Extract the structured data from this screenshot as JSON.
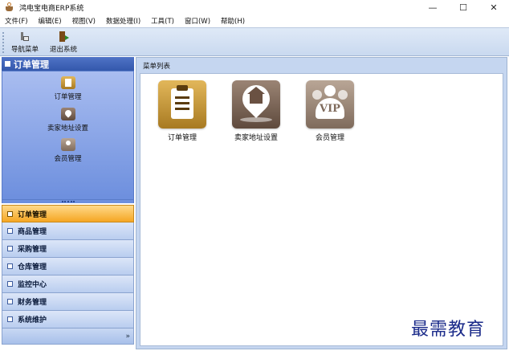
{
  "window": {
    "title": "鸿电宝电商ERP系统",
    "minimize": "—",
    "maximize": "☐",
    "close": "✕"
  },
  "menu": [
    "文件(F)",
    "编辑(E)",
    "视图(V)",
    "数据处理(I)",
    "工具(T)",
    "窗口(W)",
    "帮助(H)"
  ],
  "toolbar": {
    "nav_label": "导航菜单",
    "exit_label": "退出系统"
  },
  "left": {
    "header": "订单管理",
    "items": [
      "订单管理",
      "卖家地址设置",
      "会员管理"
    ],
    "groups": [
      {
        "label": "订单管理",
        "active": true
      },
      {
        "label": "商品管理"
      },
      {
        "label": "采购管理"
      },
      {
        "label": "仓库管理"
      },
      {
        "label": "监控中心"
      },
      {
        "label": "财务管理"
      },
      {
        "label": "系统维护"
      }
    ],
    "more": "»"
  },
  "main": {
    "header": "菜单列表",
    "tiles": [
      "订单管理",
      "卖家地址设置",
      "会员管理"
    ],
    "vip_text": "VIP"
  },
  "watermark": "最需教育",
  "colors": {
    "accent_blue": "#3458ac",
    "active_orange": "#f5a623",
    "watermark": "#1b2b8a"
  }
}
